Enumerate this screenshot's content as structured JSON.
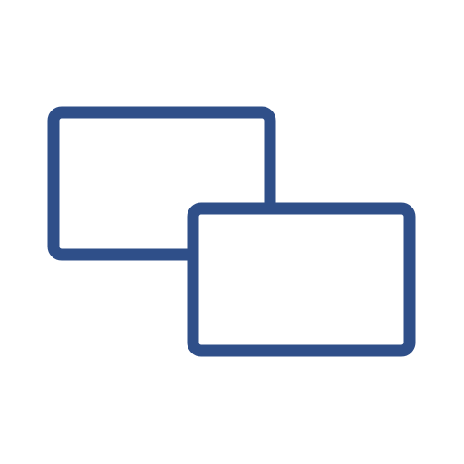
{
  "icon": {
    "name": "overlapping-rectangles-icon",
    "stroke_color": "#2F4F89",
    "fill_color": "#FFFFFF",
    "background_color": "#FFFFFF"
  }
}
